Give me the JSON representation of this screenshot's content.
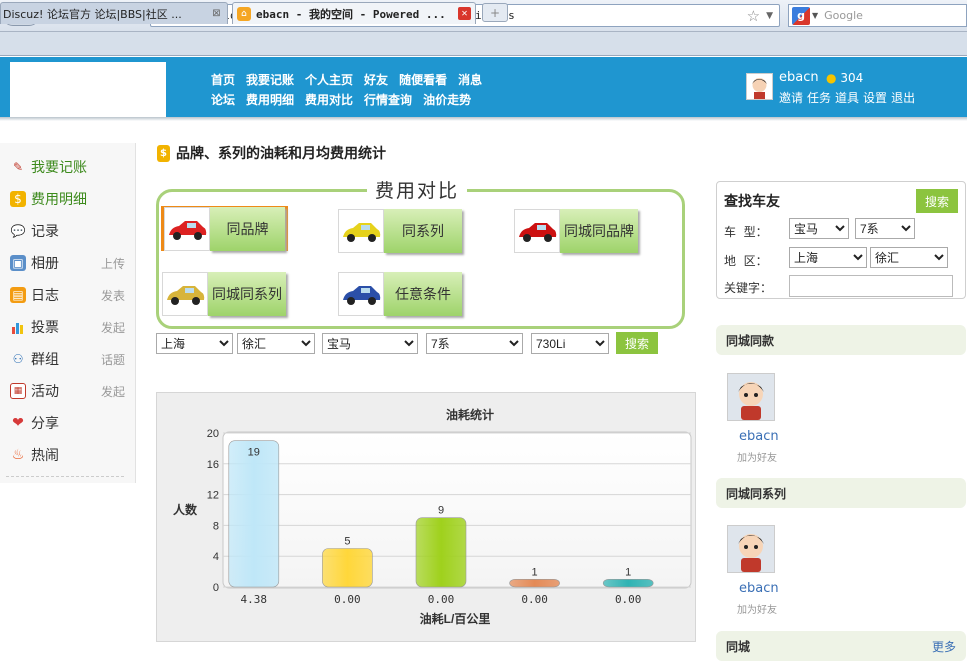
{
  "browser": {
    "url": "http://localhost/liche365/fee.php?do=datastatistics",
    "search_placeholder": "Google",
    "tabs": [
      {
        "label": "Discuz! 论坛官方 论坛|BBS|社区 ..."
      },
      {
        "label": "ebacn - 我的空间 - Powered ..."
      }
    ]
  },
  "header": {
    "nav_row1": [
      "首页",
      "我要记账",
      "个人主页",
      "好友",
      "随便看看",
      "消息"
    ],
    "nav_row2": [
      "论坛",
      "费用明细",
      "费用对比",
      "行情查询",
      "油价走势"
    ],
    "username": "ebacn",
    "coins": "304",
    "user_links": [
      "邀请",
      "任务",
      "道具",
      "设置",
      "退出"
    ]
  },
  "sidebar": {
    "items": [
      {
        "label": "我要记账",
        "icon": "pencil-icon",
        "action": ""
      },
      {
        "label": "费用明细",
        "icon": "money-icon",
        "action": ""
      },
      {
        "label": "记录",
        "icon": "speech-bubble-icon",
        "action": ""
      },
      {
        "label": "相册",
        "icon": "photo-icon",
        "action": "上传"
      },
      {
        "label": "日志",
        "icon": "notebook-icon",
        "action": "发表"
      },
      {
        "label": "投票",
        "icon": "bar-chart-icon",
        "action": "发起"
      },
      {
        "label": "群组",
        "icon": "group-icon",
        "action": "话题"
      },
      {
        "label": "活动",
        "icon": "calendar-icon",
        "action": "发起"
      },
      {
        "label": "分享",
        "icon": "heart-icon",
        "action": ""
      },
      {
        "label": "热闹",
        "icon": "flame-icon",
        "action": ""
      }
    ]
  },
  "main": {
    "title": "品牌、系列的油耗和月均费用统计",
    "compare_title": "费用对比",
    "compare_buttons": [
      "同品牌",
      "同系列",
      "同城同品牌",
      "同城同系列",
      "任意条件"
    ],
    "filters": [
      "上海",
      "徐汇",
      "宝马",
      "7系",
      "730Li"
    ],
    "search_label": "搜索"
  },
  "chart_data": {
    "type": "bar",
    "title": "油耗统计",
    "xlabel": "油耗L/百公里",
    "ylabel": "人数",
    "ylim": [
      0,
      20
    ],
    "yticks": [
      0,
      4,
      8,
      12,
      16,
      20
    ],
    "categories": [
      "4.38",
      "0.00",
      "0.00",
      "0.00",
      "0.00"
    ],
    "values": [
      19,
      5,
      9,
      1,
      1
    ],
    "colors": [
      "#bfe7f8",
      "#ffd73a",
      "#9fd11c",
      "#e48a56",
      "#2fb3b3"
    ]
  },
  "right": {
    "find_title": "查找车友",
    "find_search_label": "搜索",
    "car_type_label": "车  型：",
    "car_type_values": [
      "宝马",
      "7系"
    ],
    "area_label": "地  区：",
    "area_values": [
      "上海",
      "徐汇"
    ],
    "keyword_label": "关键字：",
    "section1_title": "同城同款",
    "section2_title": "同城同系列",
    "section3_title": "同城",
    "more_label": "更多",
    "friend_name": "ebacn",
    "add_friend_label": "加为好友"
  }
}
